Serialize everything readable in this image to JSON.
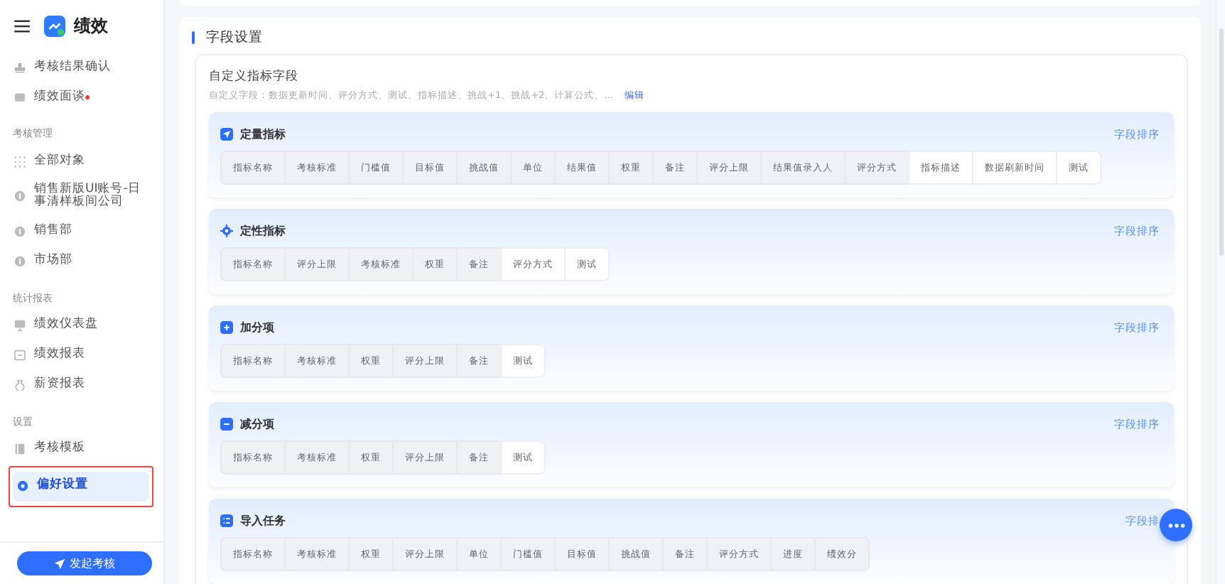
{
  "sidebar": {
    "app_title": "绩效",
    "groups": [
      {
        "items": [
          {
            "label": "考核结果确认",
            "kind": "stamp",
            "selected": false,
            "badge_dot": false
          },
          {
            "label": "绩效面谈",
            "kind": "chat",
            "selected": false,
            "badge_dot": true
          }
        ]
      },
      {
        "title": "考核管理",
        "items": [
          {
            "label": "全部对象",
            "kind": "all",
            "selected": false,
            "badge_dot": false
          },
          {
            "label": "销售新版UI账号-日事清样板间公司",
            "kind": "dept",
            "selected": false,
            "badge_dot": false
          },
          {
            "label": "销售部",
            "kind": "dept",
            "selected": false,
            "badge_dot": false
          },
          {
            "label": "市场部",
            "kind": "dept",
            "selected": false,
            "badge_dot": false
          }
        ]
      },
      {
        "title": "统计报表",
        "items": [
          {
            "label": "绩效仪表盘",
            "kind": "dashboard",
            "selected": false,
            "badge_dot": false
          },
          {
            "label": "绩效报表",
            "kind": "report",
            "selected": false,
            "badge_dot": false
          },
          {
            "label": "薪资报表",
            "kind": "salary",
            "selected": false,
            "badge_dot": false
          }
        ]
      },
      {
        "title": "设置",
        "items": [
          {
            "label": "考核模板",
            "kind": "template",
            "selected": false,
            "badge_dot": false
          },
          {
            "label": "偏好设置",
            "kind": "preference",
            "selected": true,
            "badge_dot": false
          }
        ]
      }
    ],
    "launch_button": "发起考核"
  },
  "page": {
    "title": "字段设置",
    "custom_fields": {
      "title": "自定义指标字段",
      "description": "自定义字段：数据更新时间、评分方式、测试、指标描述、挑战+1、挑战+2、计算公式、...",
      "edit_link": "编辑"
    },
    "sections": [
      {
        "kind": "quantitative",
        "title": "定量指标",
        "sort_link": "字段排序",
        "fields": [
          {
            "label": "指标名称",
            "custom": false
          },
          {
            "label": "考核标准",
            "custom": false
          },
          {
            "label": "门槛值",
            "custom": false
          },
          {
            "label": "目标值",
            "custom": false
          },
          {
            "label": "挑战值",
            "custom": false
          },
          {
            "label": "单位",
            "custom": false
          },
          {
            "label": "结果值",
            "custom": false
          },
          {
            "label": "权重",
            "custom": false
          },
          {
            "label": "备注",
            "custom": false
          },
          {
            "label": "评分上限",
            "custom": false
          },
          {
            "label": "结果值录入人",
            "custom": false
          },
          {
            "label": "评分方式",
            "custom": false
          },
          {
            "label": "指标描述",
            "custom": true
          },
          {
            "label": "数据刷新时间",
            "custom": true
          },
          {
            "label": "测试",
            "custom": true
          }
        ]
      },
      {
        "kind": "qualitative",
        "title": "定性指标",
        "sort_link": "字段排序",
        "fields": [
          {
            "label": "指标名称",
            "custom": false
          },
          {
            "label": "评分上限",
            "custom": false
          },
          {
            "label": "考核标准",
            "custom": false
          },
          {
            "label": "权重",
            "custom": false
          },
          {
            "label": "备注",
            "custom": false
          },
          {
            "label": "评分方式",
            "custom": true
          },
          {
            "label": "测试",
            "custom": true
          }
        ]
      },
      {
        "kind": "bonus",
        "title": "加分项",
        "sort_link": "字段排序",
        "fields": [
          {
            "label": "指标名称",
            "custom": false
          },
          {
            "label": "考核标准",
            "custom": false
          },
          {
            "label": "权重",
            "custom": false
          },
          {
            "label": "评分上限",
            "custom": false
          },
          {
            "label": "备注",
            "custom": false
          },
          {
            "label": "测试",
            "custom": true
          }
        ]
      },
      {
        "kind": "deduction",
        "title": "减分项",
        "sort_link": "字段排序",
        "fields": [
          {
            "label": "指标名称",
            "custom": false
          },
          {
            "label": "考核标准",
            "custom": false
          },
          {
            "label": "权重",
            "custom": false
          },
          {
            "label": "评分上限",
            "custom": false
          },
          {
            "label": "备注",
            "custom": false
          },
          {
            "label": "测试",
            "custom": true
          }
        ]
      },
      {
        "kind": "import",
        "title": "导入任务",
        "sort_link": "字段排",
        "fields": [
          {
            "label": "指标名称",
            "custom": false
          },
          {
            "label": "考核标准",
            "custom": false
          },
          {
            "label": "权重",
            "custom": false
          },
          {
            "label": "评分上限",
            "custom": false
          },
          {
            "label": "单位",
            "custom": false
          },
          {
            "label": "门槛值",
            "custom": false
          },
          {
            "label": "目标值",
            "custom": false
          },
          {
            "label": "挑战值",
            "custom": false
          },
          {
            "label": "备注",
            "custom": false
          },
          {
            "label": "评分方式",
            "custom": false
          },
          {
            "label": "进度",
            "custom": false
          },
          {
            "label": "绩效分",
            "custom": false
          }
        ]
      }
    ]
  }
}
